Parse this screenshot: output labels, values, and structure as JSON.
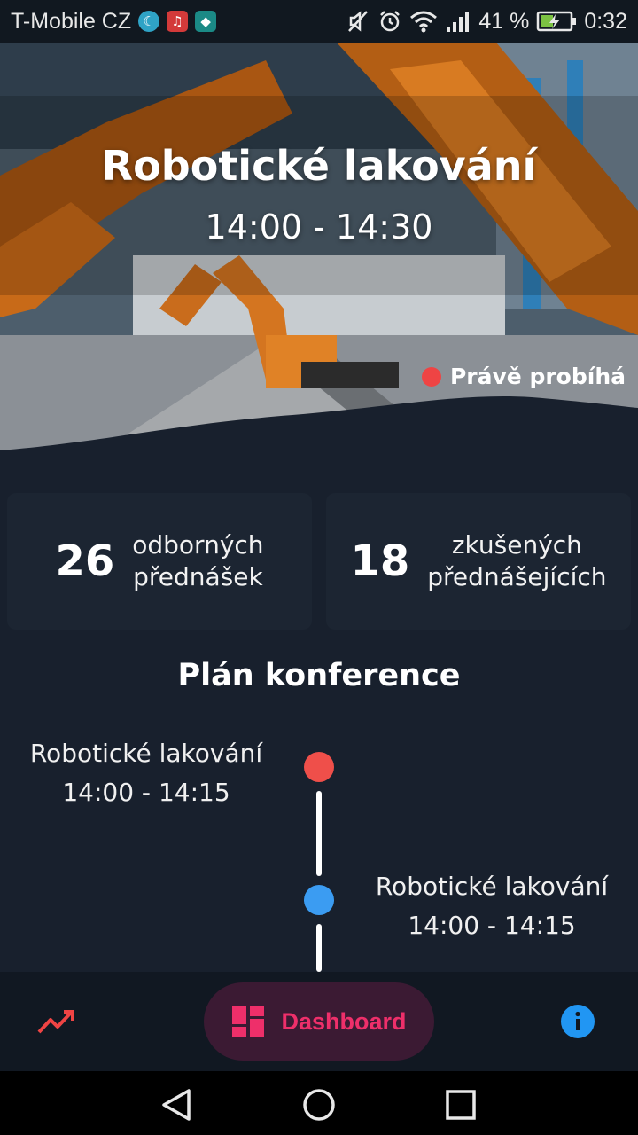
{
  "status_bar": {
    "carrier": "T-Mobile CZ",
    "battery": "41 %",
    "time": "0:32",
    "icons": [
      "moon-app-icon",
      "music-app-icon",
      "android-app-icon",
      "mute-icon",
      "alarm-icon",
      "wifi-icon",
      "signal-icon",
      "battery-charging-icon"
    ]
  },
  "hero": {
    "title": "Robotické lakování",
    "time": "14:00 - 14:30",
    "live_label": "Právě probíhá",
    "live_color": "#ef4444"
  },
  "stats": [
    {
      "number": "26",
      "label_line1": "odborných",
      "label_line2": "přednášek"
    },
    {
      "number": "18",
      "label_line1": "zkušených",
      "label_line2": "přednášejících"
    }
  ],
  "plan": {
    "title": "Plán konference",
    "items": [
      {
        "title": "Robotické lakování",
        "time": "14:00 - 14:15",
        "dot_color": "#ef4f4a"
      },
      {
        "title": "Robotické lakování",
        "time": "14:00 - 14:15",
        "dot_color": "#3b9cf2"
      }
    ]
  },
  "bottom_nav": {
    "trend_icon": "trending-up-icon",
    "dashboard_label": "Dashboard",
    "dashboard_icon": "dashboard-icon",
    "info_icon": "info-icon",
    "accent": "#ee2f6a"
  },
  "system_nav": [
    "back-icon",
    "home-icon",
    "recents-icon"
  ]
}
